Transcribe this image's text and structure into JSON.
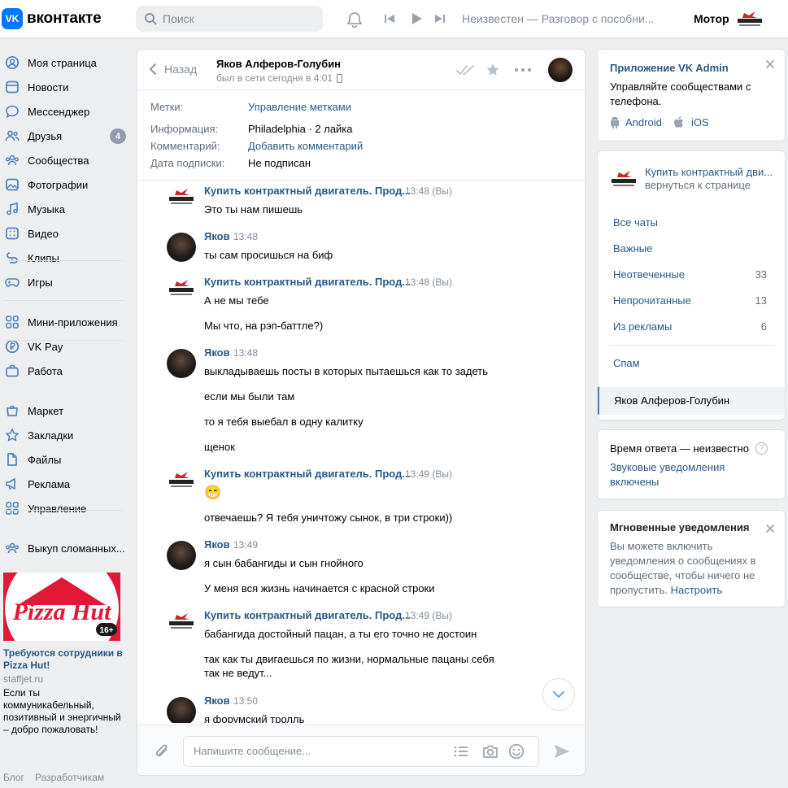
{
  "header": {
    "logo_text": "вконтакте",
    "logo_mark": "VK",
    "search_placeholder": "Поиск",
    "player_text": "Неизвестен — Разговор с пособни...",
    "user_name": "Мотор",
    "colors": {
      "brand": "#0077ff",
      "link": "#2a5885"
    }
  },
  "nav": {
    "items": [
      {
        "label": "Моя страница",
        "icon": "user-circle-icon"
      },
      {
        "label": "Новости",
        "icon": "news-icon"
      },
      {
        "label": "Мессенджер",
        "icon": "message-icon"
      },
      {
        "label": "Друзья",
        "icon": "friends-icon",
        "badge": "4"
      },
      {
        "label": "Сообщества",
        "icon": "communities-icon"
      },
      {
        "label": "Фотографии",
        "icon": "photo-icon"
      },
      {
        "label": "Музыка",
        "icon": "music-icon"
      },
      {
        "label": "Видео",
        "icon": "video-icon"
      },
      {
        "label": "Клипы",
        "icon": "clips-icon"
      },
      {
        "label": "Игры",
        "icon": "gamepad-icon"
      },
      {
        "label": "Мини-приложения",
        "icon": "apps-icon"
      },
      {
        "label": "VK Pay",
        "icon": "vkpay-icon"
      },
      {
        "label": "Работа",
        "icon": "briefcase-icon"
      },
      {
        "label": "Маркет",
        "icon": "market-icon"
      },
      {
        "label": "Закладки",
        "icon": "star-icon"
      },
      {
        "label": "Файлы",
        "icon": "file-icon"
      },
      {
        "label": "Реклама",
        "icon": "megaphone-icon"
      },
      {
        "label": "Управление",
        "icon": "apps-icon"
      },
      {
        "label": "Выкуп сломанных...",
        "icon": "communities-icon"
      }
    ]
  },
  "ad": {
    "image_text": "Pizza Hut",
    "age": "16+",
    "title": "Требуются сотрудники в Pizza Hut!",
    "domain": "staffjet.ru",
    "body": "Если ты коммуникабельный, позитивный и энергичный – добро пожаловать!"
  },
  "footer": {
    "blog": "Блог",
    "dev": "Разработчикам"
  },
  "chat": {
    "back_label": "Назад",
    "name": "Яков Алферов-Голубин",
    "status": "был в сети сегодня в 4:01",
    "info": [
      {
        "key": "Метки:",
        "value": "Управление метками",
        "link": true
      },
      {
        "key": "Информация:",
        "value": "Philadelphia · 2 лайка",
        "link": false
      },
      {
        "key": "Комментарий:",
        "value": "Добавить комментарий",
        "link": true
      },
      {
        "key": "Дата подписки:",
        "value": "Не подписан",
        "link": false
      }
    ],
    "messages": [
      {
        "author": "Купить контрактный двигатель. Прод...",
        "time": "13:48",
        "you": "(Вы)",
        "brand": true,
        "lines": [
          "Это ты нам пишешь"
        ]
      },
      {
        "author": "Яков",
        "time": "13:48",
        "you": "",
        "brand": false,
        "lines": [
          "ты сам просишься на биф"
        ]
      },
      {
        "author": "Купить контрактный двигатель. Прод...",
        "time": "13:48",
        "you": "(Вы)",
        "brand": true,
        "lines": [
          "А не мы тебе",
          "Мы что, на рэп-баттле?)"
        ]
      },
      {
        "author": "Яков",
        "time": "13:48",
        "you": "",
        "brand": false,
        "lines": [
          "выкладываешь посты в которых пытаешься как то задеть",
          "если мы были там",
          "то я тебя выебал в одну калитку",
          "щенок"
        ]
      },
      {
        "author": "Купить контрактный двигатель. Прод...",
        "time": "13:49",
        "you": "(Вы)",
        "brand": true,
        "lines": [
          "😁",
          "отвечаешь? Я тебя уничтожу сынок, в три строки))"
        ]
      },
      {
        "author": "Яков",
        "time": "13:49",
        "you": "",
        "brand": false,
        "lines": [
          "я сын бабангиды и сын гнойного",
          "У меня вся жизнь начинается с красной строки"
        ]
      },
      {
        "author": "Купить контрактный двигатель. Прод...",
        "time": "13:49",
        "you": "(Вы)",
        "brand": true,
        "lines": [
          "бабангида достойный пацан, а ты его точно не достоин",
          "так как ты двигаешься по жизни, нормальные пацаны себя",
          "так не ведут..."
        ]
      },
      {
        "author": "Яков",
        "time": "13:50",
        "you": "",
        "brand": false,
        "lines": [
          "я форумский тролль"
        ]
      }
    ],
    "composer_placeholder": "Напишите сообщение..."
  },
  "right": {
    "vkadmin": {
      "title": "Приложение VK Admin",
      "body": "Управляйте сообществами с телефона.",
      "android": "Android",
      "ios": "iOS"
    },
    "community": {
      "name": "Купить контрактный дви...",
      "back": "вернуться к странице"
    },
    "filters": [
      {
        "label": "Все чаты",
        "count": ""
      },
      {
        "label": "Важные",
        "count": ""
      },
      {
        "label": "Неотвеченные",
        "count": "33"
      },
      {
        "label": "Непрочитанные",
        "count": "13"
      },
      {
        "label": "Из рекламы",
        "count": "6"
      },
      {
        "label": "Спам",
        "count": ""
      }
    ],
    "active_chat": "Яков Алферов-Голубин",
    "response": {
      "time_text": "Время ответа — неизвестно",
      "sound": "Звуковые уведомления включены"
    },
    "instant": {
      "title": "Мгновенные уведомления",
      "body": "Вы можете включить уведомления о сообщениях в сообществе, чтобы ничего не пропустить.",
      "link": "Настроить"
    }
  }
}
